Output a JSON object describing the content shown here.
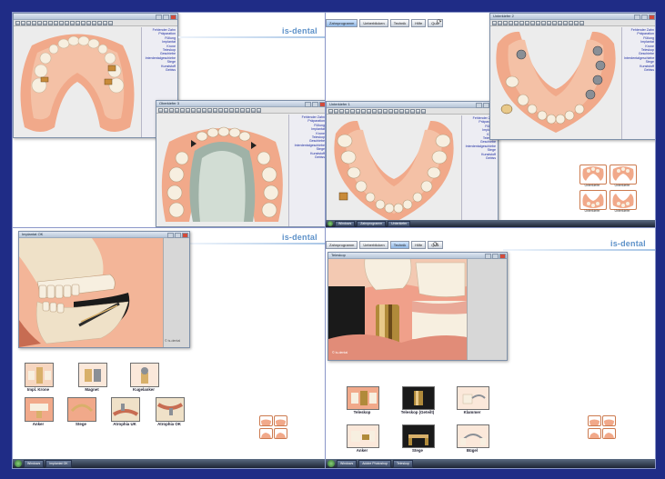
{
  "colors": {
    "border": "#1f2c86",
    "brand": "#5e92c9",
    "gum": "#f1a98a",
    "tooth": "#f7efe0",
    "bone": "#f6d6c0"
  },
  "brand": "is-dental",
  "tabs": [
    "Zahnprogramm",
    "Ueberblicken",
    "Technik",
    "Hilfe",
    "Quiz"
  ],
  "info_panel": [
    "Fehlender Zahn",
    "Präparation",
    "Füllung",
    "Implantat",
    "Krone",
    "Teleskop",
    "Geschiebe",
    "Interdentalgeschiebe",
    "Stege",
    "Kunststoff",
    "Gebiss"
  ],
  "panels": {
    "top_left": {
      "window_title": ""
    },
    "top_mid": {
      "window_title": "Oberkiefer 3"
    },
    "top_right_back": {
      "window_title": "Unterkiefer 1"
    },
    "top_right_front": {
      "window_title": "Unterkiefer 2"
    },
    "mini_labels": [
      "Unterkiefer",
      "Unterkiefer",
      "Unterkiefer",
      "Unterkiefer"
    ],
    "bottom_left": {
      "window_title": "Implantat OK",
      "watermark": "© is-dental",
      "thumbs": [
        {
          "label": "Impl. Krone"
        },
        {
          "label": "Magnet"
        },
        {
          "label": "Kugelanker"
        },
        {
          "label": "Anker"
        },
        {
          "label": "Stege"
        },
        {
          "label": "Atrophia UK"
        },
        {
          "label": "Atrophia OK"
        }
      ]
    },
    "bottom_right": {
      "window_title": "Teleskop",
      "watermark": "© is-dental",
      "thumbs": [
        {
          "label": "Teleskop"
        },
        {
          "label": "Teleskop (Geteilt)"
        },
        {
          "label": "Klammer"
        },
        {
          "label": "Anker"
        },
        {
          "label": "Stege"
        },
        {
          "label": "Bügel"
        }
      ]
    }
  },
  "taskbar": {
    "left_items": [
      "Windows",
      "Implantat OK"
    ],
    "right_items": [
      "Windows",
      "Adobe Photoshop",
      "Teleskop"
    ]
  },
  "taskbar_top": {
    "items": [
      "Windows",
      "Zahnprogramm",
      "Unterkiefer"
    ]
  }
}
